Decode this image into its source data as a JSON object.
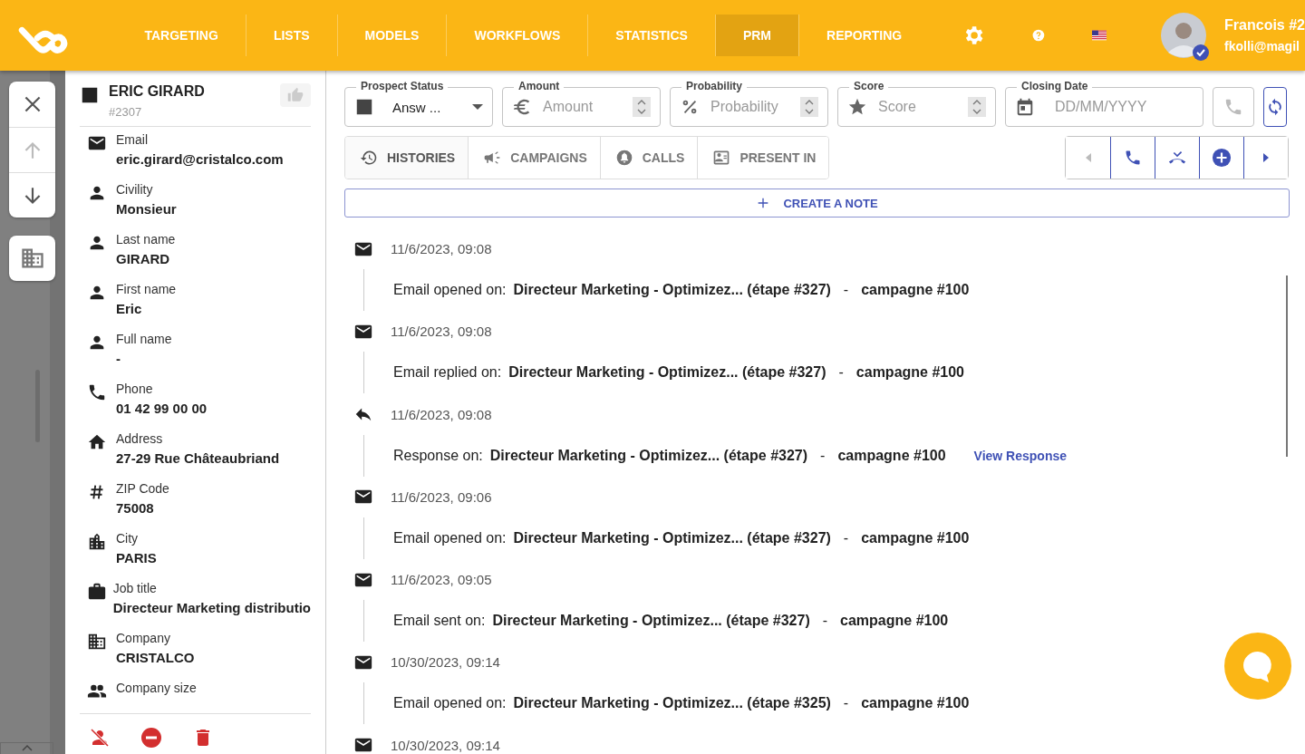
{
  "nav": [
    {
      "label": "TARGETING",
      "selected": false
    },
    {
      "label": "LISTS",
      "selected": false
    },
    {
      "label": "MODELS",
      "selected": false
    },
    {
      "label": "WORKFLOWS",
      "selected": false
    },
    {
      "label": "STATISTICS",
      "selected": false
    },
    {
      "label": "PRM",
      "selected": true
    },
    {
      "label": "REPORTING",
      "selected": false
    }
  ],
  "user": {
    "name": "Francois #2",
    "email": "fkolli@magil"
  },
  "contact": {
    "name": "ERIC GIRARD",
    "id": "#2307",
    "fields": [
      {
        "kind": "email",
        "label": "Email",
        "value": "eric.girard@cristalco.com"
      },
      {
        "kind": "person",
        "label": "Civility",
        "value": "Monsieur"
      },
      {
        "kind": "person",
        "label": "Last name",
        "value": "GIRARD"
      },
      {
        "kind": "person",
        "label": "First name",
        "value": "Eric"
      },
      {
        "kind": "person",
        "label": "Full name",
        "value": "-"
      },
      {
        "kind": "phone",
        "label": "Phone",
        "value": "01 42 99 00 00"
      },
      {
        "kind": "home",
        "label": "Address",
        "value": "27-29 Rue Châteaubriand"
      },
      {
        "kind": "hash",
        "label": "ZIP Code",
        "value": "75008"
      },
      {
        "kind": "city",
        "label": "City",
        "value": "PARIS"
      },
      {
        "kind": "job",
        "label": "Job title",
        "value": "Directeur Marketing distributio"
      },
      {
        "kind": "company",
        "label": "Company",
        "value": "CRISTALCO"
      },
      {
        "kind": "group",
        "label": "Company size"
      }
    ]
  },
  "filters": [
    {
      "kind": "select",
      "label": "Prospect Status",
      "value": "Answ ..."
    },
    {
      "kind": "amount",
      "label": "Amount",
      "placeholder": "Amount"
    },
    {
      "kind": "probability",
      "label": "Probability",
      "placeholder": "Probability"
    },
    {
      "kind": "score",
      "label": "Score",
      "placeholder": "Score"
    },
    {
      "kind": "date",
      "label": "Closing Date",
      "placeholder": "DD/MM/YYYY"
    }
  ],
  "tabs": [
    {
      "kind": "history",
      "label": "HISTORIES",
      "selected": true
    },
    {
      "kind": "campaign",
      "label": "CAMPAIGNS",
      "selected": false
    },
    {
      "kind": "bell",
      "label": "CALLS",
      "selected": false
    },
    {
      "kind": "present",
      "label": "PRESENT IN",
      "selected": false
    }
  ],
  "create_note": "CREATE A NOTE",
  "timeline": [
    {
      "kind": "email",
      "date": "11/6/2023, 09:08",
      "prefix": "Email opened on:",
      "title": "Directeur Marketing - Optimizez... (étape #327)",
      "separator": "-",
      "campaign": "campagne #100"
    },
    {
      "kind": "email",
      "date": "11/6/2023, 09:08",
      "prefix": "Email replied on:",
      "title": "Directeur Marketing - Optimizez... (étape #327)",
      "separator": "-",
      "campaign": "campagne #100"
    },
    {
      "kind": "reply",
      "date": "11/6/2023, 09:08",
      "prefix": "Response on:",
      "title": "Directeur Marketing - Optimizez... (étape #327)",
      "separator": "-",
      "campaign": "campagne #100",
      "link": "View Response"
    },
    {
      "kind": "email",
      "date": "11/6/2023, 09:06",
      "prefix": "Email opened on:",
      "title": "Directeur Marketing - Optimizez... (étape #327)",
      "separator": "-",
      "campaign": "campagne #100"
    },
    {
      "kind": "email",
      "date": "11/6/2023, 09:05",
      "prefix": "Email sent on:",
      "title": "Directeur Marketing - Optimizez... (étape #327)",
      "separator": "-",
      "campaign": "campagne #100"
    },
    {
      "kind": "email",
      "date": "10/30/2023, 09:14",
      "prefix": "Email opened on:",
      "title": "Directeur Marketing - Optimizez... (étape #325)",
      "separator": "-",
      "campaign": "campagne #100"
    },
    {
      "kind": "email",
      "date": "10/30/2023, 09:14"
    }
  ]
}
